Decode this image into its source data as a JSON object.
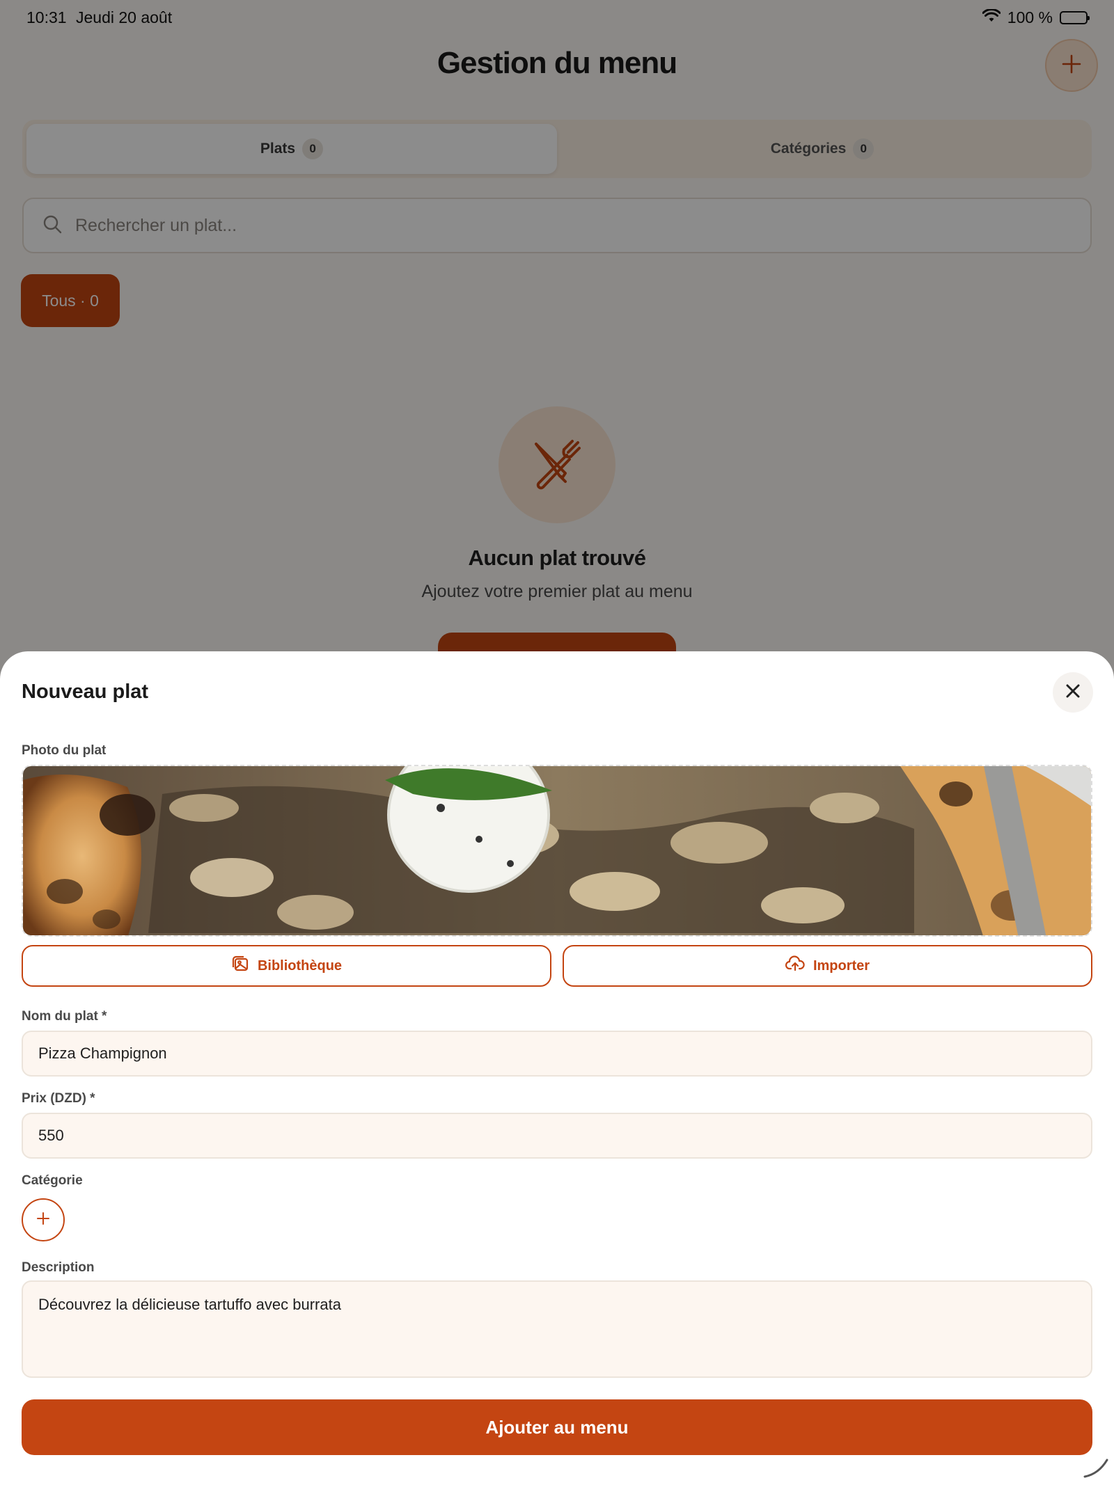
{
  "status_bar": {
    "time": "10:31",
    "date": "Jeudi 20 août",
    "battery": "100 %",
    "icons": [
      "wifi-icon",
      "battery-icon"
    ]
  },
  "header": {
    "title": "Gestion du menu",
    "add_icon": "plus-icon"
  },
  "tabs": [
    {
      "label": "Plats",
      "count": "0",
      "active": true
    },
    {
      "label": "Catégories",
      "count": "0",
      "active": false
    }
  ],
  "search": {
    "placeholder": "Rechercher un plat...",
    "icon": "search-icon"
  },
  "filters": [
    {
      "label": "Tous · 0",
      "active": true
    }
  ],
  "empty_state": {
    "icon": "utensils-crossed-icon",
    "title": "Aucun plat trouvé",
    "subtitle": "Ajoutez votre premier plat au menu"
  },
  "sheet": {
    "title": "Nouveau plat",
    "close_icon": "close-icon",
    "photo_label": "Photo du plat",
    "photo_alt": "pizza-photo",
    "library_label": "Bibliothèque",
    "library_icon": "image-gallery-icon",
    "import_label": "Importer",
    "import_icon": "cloud-upload-icon",
    "name_label": "Nom du plat *",
    "name_value": "Pizza Champignon",
    "price_label": "Prix (DZD) *",
    "price_value": "550",
    "category_label": "Catégorie",
    "category_add_icon": "plus-icon",
    "description_label": "Description",
    "description_value": "Découvrez la délicieuse tartuffo avec burrata",
    "submit_label": "Ajouter au menu"
  },
  "colors": {
    "accent": "#c44512",
    "accent_soft": "#fbe6d4",
    "field_bg": "#fdf6f0",
    "overlay": "rgba(0,0,0,0.45)"
  }
}
